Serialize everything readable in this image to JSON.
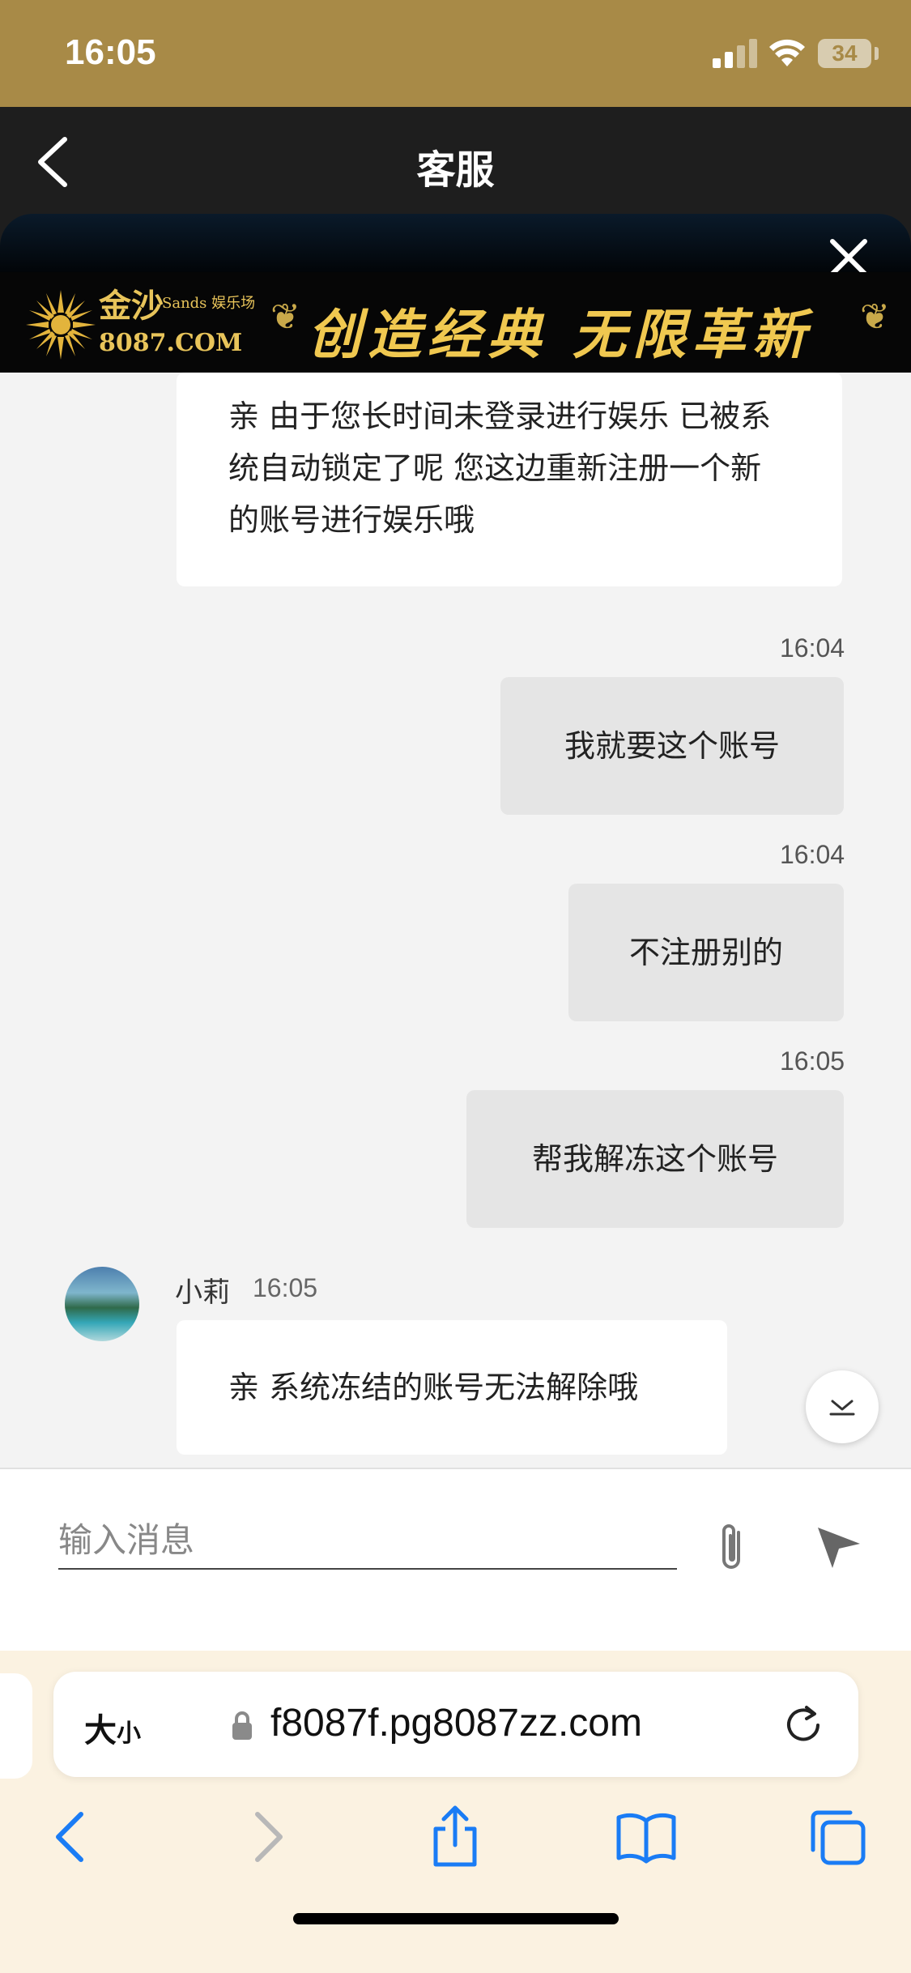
{
  "status_bar": {
    "time": "16:05",
    "battery": "34"
  },
  "nav": {
    "title": "客服"
  },
  "banner": {
    "logo_name": "金沙",
    "logo_sub": "Sands 娱乐场",
    "logo_url": "8087.COM",
    "slogan": "创造经典 无限革新"
  },
  "chat": {
    "agent_name": "小莉",
    "messages": [
      {
        "from": "agent",
        "text": "亲 由于您长时间未登录进行娱乐 已被系统自动锁定了呢 您这边重新注册一个新的账号进行娱乐哦"
      },
      {
        "from": "user",
        "time": "16:04",
        "text": "我就要这个账号"
      },
      {
        "from": "user",
        "time": "16:04",
        "text": "不注册别的"
      },
      {
        "from": "user",
        "time": "16:05",
        "text": "帮我解冻这个账号"
      },
      {
        "from": "agent",
        "time": "16:05",
        "text": "亲 系统冻结的账号无法解除哦"
      }
    ]
  },
  "input": {
    "placeholder": "输入消息"
  },
  "browser": {
    "text_size_big": "大",
    "text_size_small": "小",
    "url": "f8087f.pg8087zz.com"
  },
  "colors": {
    "status_bar": "#a88a47",
    "nav_bar": "#1e1e1e",
    "banner_gold": "#f0c850",
    "user_bubble": "#e5e5e5",
    "browser_bg": "#fbf2e1",
    "toolbar_blue": "#1a7cf5"
  },
  "icons": [
    "back-chevron-icon",
    "close-icon",
    "scroll-down-icon",
    "paperclip-icon",
    "send-icon",
    "lock-icon",
    "reload-icon",
    "browser-back-icon",
    "browser-forward-icon",
    "share-icon",
    "bookmarks-icon",
    "tabs-icon"
  ]
}
